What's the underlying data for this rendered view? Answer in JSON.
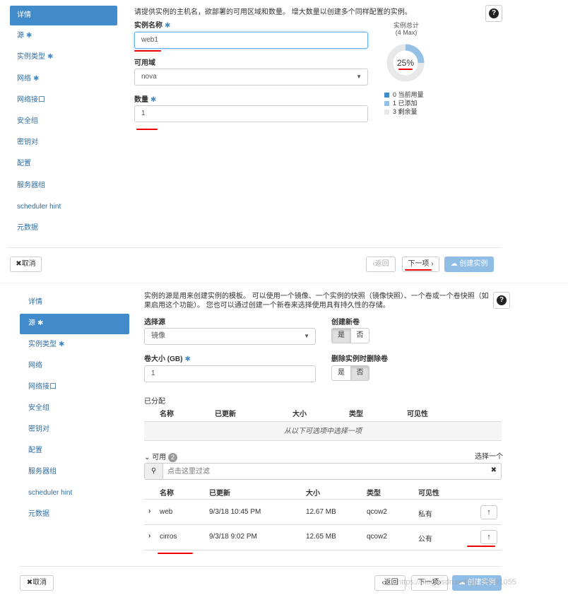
{
  "panel1": {
    "nav": [
      "详情",
      "源",
      "实例类型",
      "网络",
      "网络接口",
      "安全组",
      "密钥对",
      "配置",
      "服务器组",
      "scheduler hint",
      "元数据"
    ],
    "description": "请提供实例的主机名，欲部署的可用区域和数量。 增大数量以创建多个同样配置的实例。",
    "instance_name_label": "实例名称",
    "instance_name_value": "web1",
    "az_label": "可用域",
    "az_value": "nova",
    "count_label": "数量",
    "count_value": "1",
    "quota": {
      "title": "实例总计",
      "max": "(4 Max)",
      "percent_text": "25%",
      "percent": 25,
      "legend": [
        "0  当前用量",
        "1  已添加",
        "3  剩余量"
      ],
      "colors": [
        "#428bca",
        "#94c0e6",
        "#e8e8e8"
      ]
    },
    "cancel": "取消",
    "back": "‹返回",
    "next": "下一项 ›",
    "create": "创建实例"
  },
  "panel2": {
    "nav": [
      "详情",
      "源",
      "实例类型",
      "网络",
      "网络接口",
      "安全组",
      "密钥对",
      "配置",
      "服务器组",
      "scheduler hint",
      "元数据"
    ],
    "description": "实例的源是用来创建实例的模板。 可以使用一个镜像、一个实例的快照（镜像快照）、一个卷或一个卷快照（如果启用这个功能）。 您也可以通过创建一个新卷来选择使用具有持久性的存储。",
    "source_label": "选择源",
    "source_value": "镜像",
    "new_volume_label": "创建新卷",
    "yes": "是",
    "no": "否",
    "vol_size_label": "卷大小 (GB)",
    "vol_size_value": "1",
    "delete_label": "删除实例时删除卷",
    "allocated_label": "已分配",
    "headers": [
      "名称",
      "已更新",
      "大小",
      "类型",
      "可见性"
    ],
    "allocated_empty": "从以下可选项中选择一项",
    "available_label": "可用",
    "available_count": "2",
    "select_one": "选择一个",
    "filter_placeholder": "点击这里过滤",
    "rows": [
      {
        "name": "web",
        "updated": "9/3/18 10:45 PM",
        "size": "12.67 MB",
        "type": "qcow2",
        "visibility": "私有"
      },
      {
        "name": "cirros",
        "updated": "9/3/18 9:02 PM",
        "size": "12.65 MB",
        "type": "qcow2",
        "visibility": "公有"
      }
    ],
    "cancel": "取消",
    "back": "‹返回",
    "next": "下一项›",
    "create": "创建实例",
    "watermark": "https://blog.csdn.net/qq_33591055"
  }
}
